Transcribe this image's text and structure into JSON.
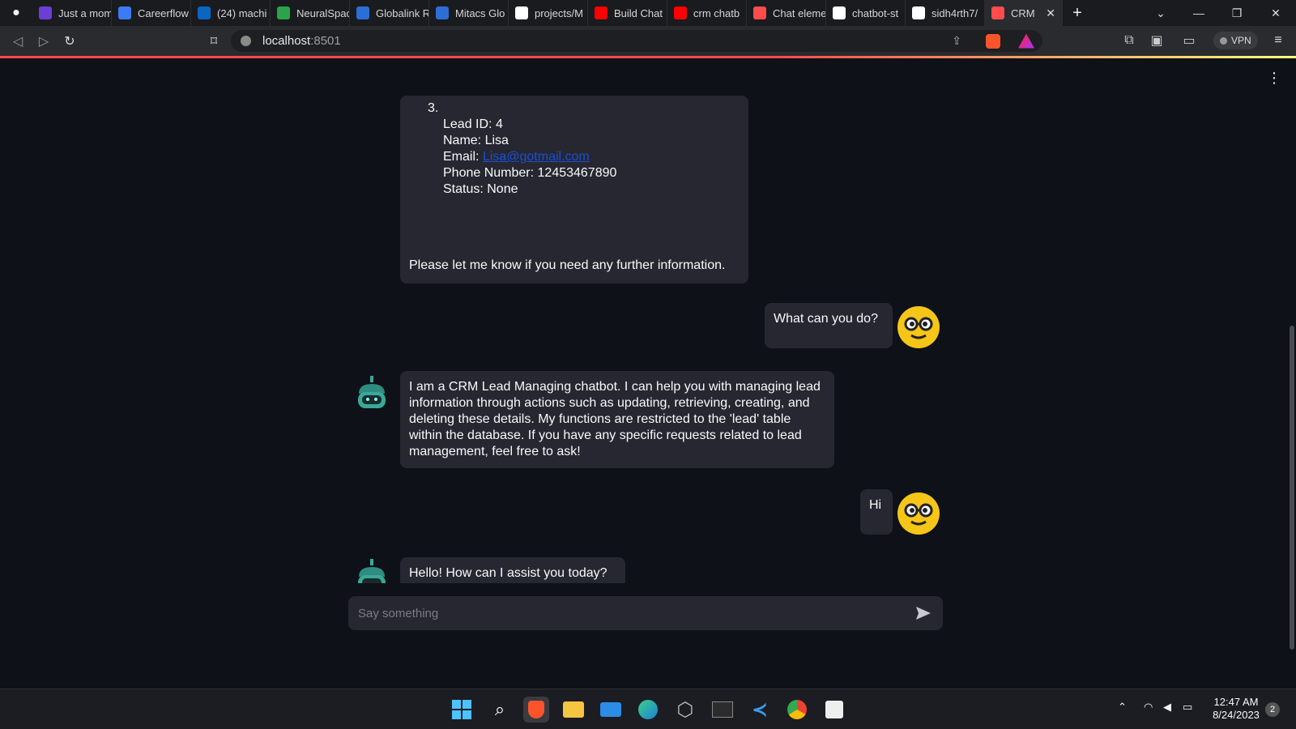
{
  "browser": {
    "tabs": [
      {
        "label": "Just a mom",
        "icon": "lobe-icon",
        "color": "#6b3fd6"
      },
      {
        "label": "Careerflow",
        "icon": "careerflow-icon",
        "color": "#3d7bf6"
      },
      {
        "label": "(24) machi",
        "icon": "linkedin-icon",
        "color": "#0a66c2"
      },
      {
        "label": "NeuralSpac",
        "icon": "neuralspace-icon",
        "color": "#2aa34a"
      },
      {
        "label": "Globalink R",
        "icon": "mitacs-icon",
        "color": "#2b6fd6"
      },
      {
        "label": "Mitacs Glo",
        "icon": "mitacs-icon",
        "color": "#2b6fd6"
      },
      {
        "label": "projects/M",
        "icon": "github-icon",
        "color": "#ffffff"
      },
      {
        "label": "Build Chat",
        "icon": "youtube-icon",
        "color": "#ff0000"
      },
      {
        "label": "crm chatb",
        "icon": "youtube-icon",
        "color": "#ff0000"
      },
      {
        "label": "Chat eleme",
        "icon": "streamlit-icon",
        "color": "#ff4b4b"
      },
      {
        "label": "chatbot-st",
        "icon": "github-icon",
        "color": "#ffffff"
      },
      {
        "label": "sidh4rth7/",
        "icon": "github-icon",
        "color": "#ffffff"
      },
      {
        "label": "CRM",
        "icon": "streamlit-icon",
        "color": "#ff4b4b"
      }
    ],
    "url_host": "localhost",
    "url_port": ":8501",
    "vpn_label": "VPN"
  },
  "chat": {
    "lead_block": {
      "number": "3.",
      "lines": [
        {
          "label": "Lead ID: ",
          "value": "4"
        },
        {
          "label": "Name: ",
          "value": "Lisa"
        },
        {
          "label": "Email: ",
          "value": "Lisa@gotmail.com"
        },
        {
          "label": "Phone Number: ",
          "value": "12453467890"
        },
        {
          "label": "Status: ",
          "value": "None"
        }
      ],
      "footer": "Please let me know if you need any further information."
    },
    "user_msg_1": "What can you do?",
    "bot_msg_1": "I am a CRM Lead Managing chatbot. I can help you with managing lead information through actions such as updating, retrieving, creating, and deleting these details. My functions are restricted to the 'lead' table within the database. If you have any specific requests related to lead management, feel free to ask!",
    "user_msg_2": "Hi",
    "bot_msg_2": "Hello! How can I assist you today?",
    "input_placeholder": "Say something"
  },
  "taskbar": {
    "time": "12:47 AM",
    "date": "8/24/2023",
    "notification_count": "2"
  },
  "colors": {
    "page_bg": "#0e1117",
    "bubble_bg": "#262730",
    "accent": "#ff4b4b",
    "link": "#1a4fd6"
  }
}
